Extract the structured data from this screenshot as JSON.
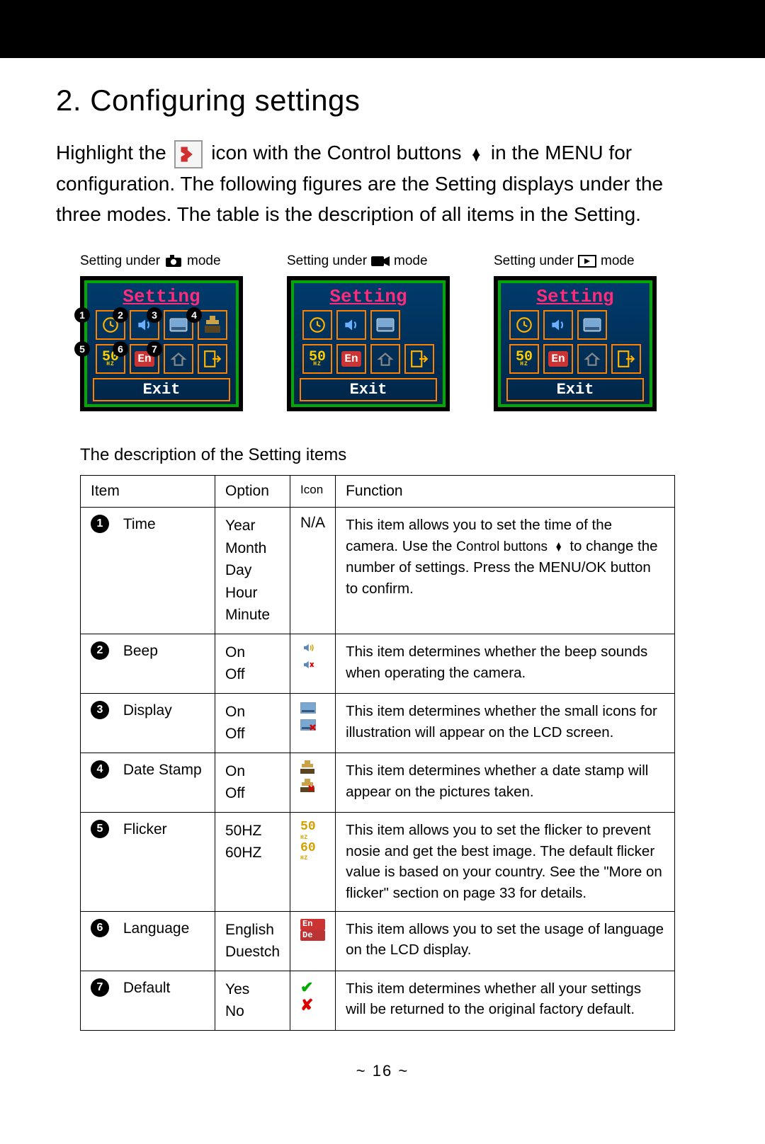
{
  "heading": "2. Configuring settings",
  "intro_before_wrench": "Highlight the ",
  "intro_mid": " icon with the Control buttons ",
  "intro_after": " in the MENU for configuration. The following figures are the Setting displays under the three modes. The table is the description of all items in the Setting.",
  "mode_caption_prefix": "Setting under ",
  "mode_caption_suffix": " mode",
  "lcd_title": "Setting",
  "lcd_exit": "Exit",
  "lcd_50": "50",
  "lcd_hz": "HZ",
  "lcd_en": "En",
  "table_caption": "The description of the Setting items",
  "headers": {
    "item": "Item",
    "option": "Option",
    "icon": "Icon",
    "function": "Function"
  },
  "rows": [
    {
      "num": "1",
      "name": "Time",
      "options": "Year\nMonth\nDay\nHour\nMinute",
      "icon_text": "N/A",
      "func_before": "This item allows you to set the time of the camera. Use the ",
      "func_ctrl": "Control buttons",
      "func_after": " to change the number of settings. Press the MENU/OK button to confirm."
    },
    {
      "num": "2",
      "name": "Beep",
      "options": "On\nOff",
      "func": "This item determines whether the beep sounds when operating the camera."
    },
    {
      "num": "3",
      "name": "Display",
      "options": "On\nOff",
      "func": "This item determines whether the small icons for illustration will appear on the LCD screen."
    },
    {
      "num": "4",
      "name": "Date Stamp",
      "options": "On\nOff",
      "func": "This item determines whether a date stamp will appear on the pictures taken."
    },
    {
      "num": "5",
      "name": "Flicker",
      "options": "50HZ\n60HZ",
      "func": "This item allows you to set the flicker to prevent nosie and get the best image. The default flicker value is based on your country. See the \"More on flicker\" section on page 33 for details."
    },
    {
      "num": "6",
      "name": "Language",
      "options": "English\nDuestch",
      "func": "This item allows you to set the usage of language on the LCD display."
    },
    {
      "num": "7",
      "name": "Default",
      "options": "Yes\nNo",
      "func": "This item determines whether all your settings will be returned to the original factory default."
    }
  ],
  "mini": {
    "fifty": "50",
    "sixty": "60",
    "hz": "HZ",
    "en": "En",
    "de": "De"
  },
  "page_number": "~  16  ~"
}
